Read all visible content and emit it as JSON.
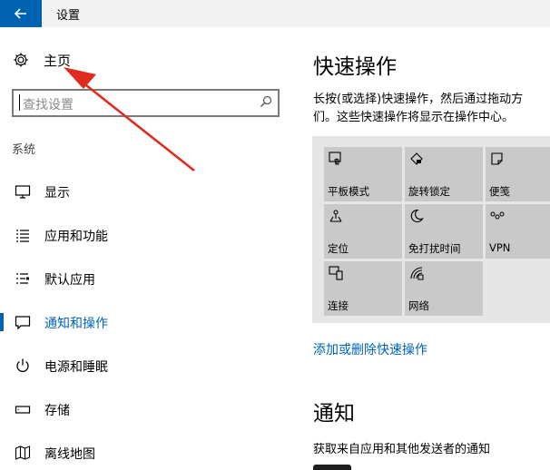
{
  "window": {
    "title": "设置"
  },
  "sidebar": {
    "home_label": "主页",
    "search": {
      "placeholder": "查找设置"
    },
    "section_label": "系统",
    "items": [
      {
        "label": "显示",
        "icon": "display-icon"
      },
      {
        "label": "应用和功能",
        "icon": "apps-list-icon"
      },
      {
        "label": "默认应用",
        "icon": "default-apps-icon"
      },
      {
        "label": "通知和操作",
        "icon": "notification-icon",
        "selected": true
      },
      {
        "label": "电源和睡眠",
        "icon": "power-icon"
      },
      {
        "label": "存储",
        "icon": "storage-icon"
      },
      {
        "label": "离线地图",
        "icon": "offline-maps-icon"
      }
    ]
  },
  "main": {
    "heading": "快速操作",
    "description_line1": "长按(或选择)快速操作，然后通过拖动方",
    "description_line2": "们。这些快速操作将显示在操作中心。",
    "quick_actions": [
      {
        "label": "平板模式",
        "icon": "tablet-mode-icon"
      },
      {
        "label": "旋转锁定",
        "icon": "rotation-lock-icon"
      },
      {
        "label": "便笺",
        "icon": "note-icon"
      },
      {
        "label": "定位",
        "icon": "location-icon"
      },
      {
        "label": "免打扰时间",
        "icon": "quiet-hours-icon"
      },
      {
        "label": "VPN",
        "icon": "vpn-icon"
      },
      {
        "label": "连接",
        "icon": "connect-icon"
      },
      {
        "label": "网络",
        "icon": "network-icon"
      }
    ],
    "add_remove_link": "添加或删除快速操作",
    "notifications_heading": "通知",
    "notifications_desc": "获取来自应用和其他发送者的通知"
  },
  "colors": {
    "accent": "#0063b1",
    "annotation_arrow": "#e02b20",
    "tile": "#c9c9c9"
  }
}
